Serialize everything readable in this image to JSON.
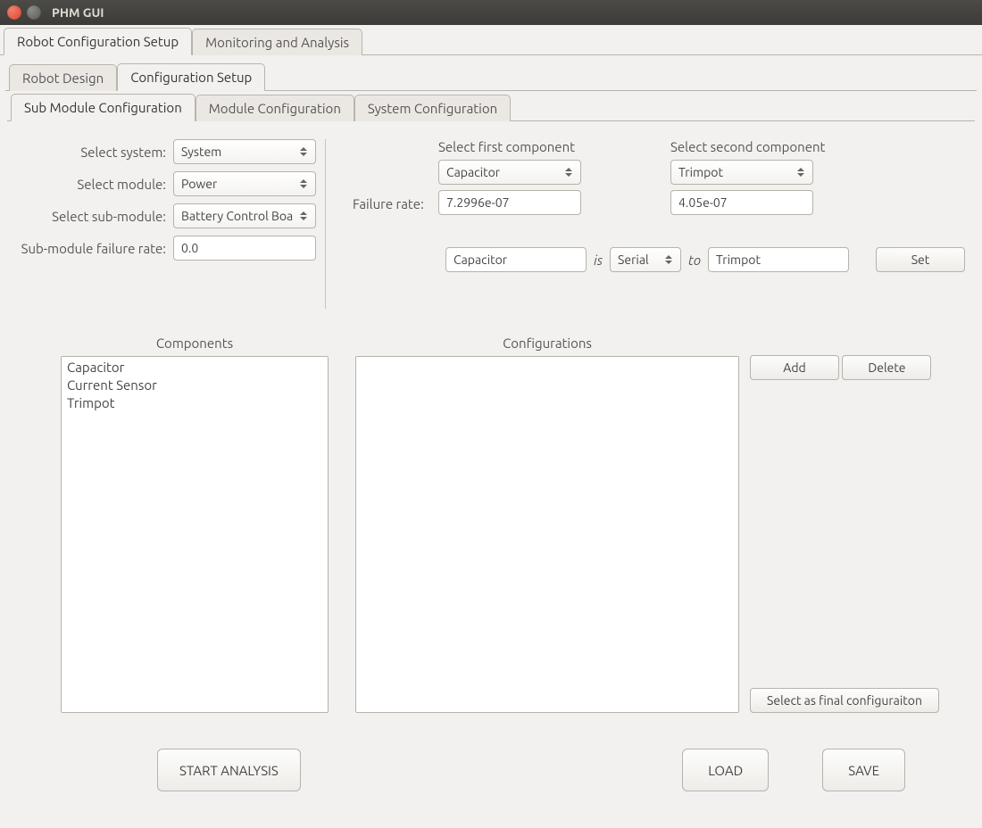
{
  "window": {
    "title": "PHM GUI"
  },
  "tabs": {
    "level1": [
      {
        "label": "Robot Configuration Setup",
        "active": true
      },
      {
        "label": "Monitoring and Analysis",
        "active": false
      }
    ],
    "level2": [
      {
        "label": "Robot Design",
        "active": false
      },
      {
        "label": "Configuration Setup",
        "active": true
      }
    ],
    "level3": [
      {
        "label": "Sub Module Configuration",
        "active": true
      },
      {
        "label": "Module Configuration",
        "active": false
      },
      {
        "label": "System Configuration",
        "active": false
      }
    ]
  },
  "left": {
    "labels": {
      "system": "Select system:",
      "module": "Select module:",
      "submodule": "Select sub-module:",
      "failrate": "Sub-module failure rate:"
    },
    "values": {
      "system": "System",
      "module": "Power",
      "submodule": "Battery Control Boa",
      "failrate": "0.0"
    }
  },
  "right": {
    "labels": {
      "first": "Select first component",
      "second": "Select second component",
      "failrate": "Failure rate:",
      "is": "is",
      "to": "to"
    },
    "first": {
      "component": "Capacitor",
      "rate": "7.2996e-07"
    },
    "second": {
      "component": "Trimpot",
      "rate": "4.05e-07"
    },
    "relation": {
      "a": "Capacitor",
      "mode": "Serial",
      "b": "Trimpot"
    },
    "set": "Set"
  },
  "lists": {
    "components_title": "Components",
    "config_title": "Configurations",
    "components": [
      "Capacitor",
      "Current Sensor",
      "Trimpot"
    ],
    "configurations": []
  },
  "buttons": {
    "add": "Add",
    "delete": "Delete",
    "select_final": "Select as final configuraiton",
    "start": "START ANALYSIS",
    "load": "LOAD",
    "save": "SAVE"
  }
}
